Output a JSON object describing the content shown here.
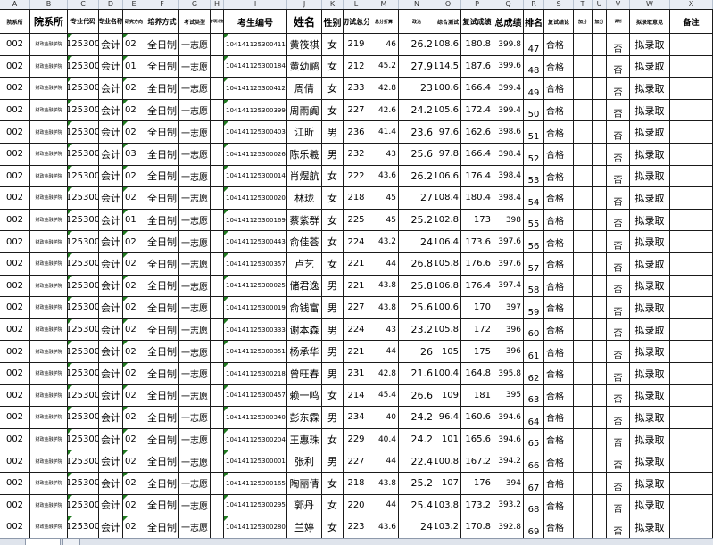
{
  "columns": [
    "A",
    "B",
    "C",
    "D",
    "E",
    "F",
    "G",
    "H",
    "I",
    "J",
    "K",
    "L",
    "M",
    "N",
    "O",
    "P",
    "Q",
    "R",
    "S",
    "T",
    "U",
    "V",
    "W",
    "X"
  ],
  "headers": [
    "院系所",
    "院系所",
    "专业代码",
    "专业名称",
    "研究方向",
    "培养方式",
    "考试类型",
    "专项计划",
    "考生编号",
    "姓名",
    "性别",
    "初试总分",
    "总分折算",
    "政治",
    "综合测试",
    "复试成绩",
    "总成绩",
    "排名",
    "复试结论",
    "加分",
    "加分",
    "调剂",
    "拟录取意见",
    "备注"
  ],
  "rows": [
    [
      "002",
      "财政金融学院",
      "125300",
      "会计",
      "02",
      "全日制",
      "一志愿",
      "",
      "104141125300411",
      "黄筱祺",
      "女",
      "219",
      "46",
      "26.2",
      "108.6",
      "180.8",
      "399.8",
      "47",
      "合格",
      "",
      "",
      "否",
      "拟录取",
      ""
    ],
    [
      "002",
      "财政金融学院",
      "125300",
      "会计",
      "01",
      "全日制",
      "一志愿",
      "",
      "104141125300184",
      "黄幼鹂",
      "女",
      "212",
      "45.2",
      "27.9",
      "114.5",
      "187.6",
      "399.6",
      "48",
      "合格",
      "",
      "",
      "否",
      "拟录取",
      ""
    ],
    [
      "002",
      "财政金融学院",
      "125300",
      "会计",
      "02",
      "全日制",
      "一志愿",
      "",
      "104141125300412",
      "周倩",
      "女",
      "233",
      "42.8",
      "23",
      "100.6",
      "166.4",
      "399.4",
      "49",
      "合格",
      "",
      "",
      "否",
      "拟录取",
      ""
    ],
    [
      "002",
      "财政金融学院",
      "125300",
      "会计",
      "02",
      "全日制",
      "一志愿",
      "",
      "104141125300399",
      "周雨阗",
      "女",
      "227",
      "42.6",
      "24.2",
      "105.6",
      "172.4",
      "399.4",
      "50",
      "合格",
      "",
      "",
      "否",
      "拟录取",
      ""
    ],
    [
      "002",
      "财政金融学院",
      "125300",
      "会计",
      "02",
      "全日制",
      "一志愿",
      "",
      "104141125300403",
      "江昕",
      "男",
      "236",
      "41.4",
      "23.6",
      "97.6",
      "162.6",
      "398.6",
      "51",
      "合格",
      "",
      "",
      "否",
      "拟录取",
      ""
    ],
    [
      "002",
      "财政金融学院",
      "125300",
      "会计",
      "03",
      "全日制",
      "一志愿",
      "",
      "104141125300026",
      "陈乐羲",
      "男",
      "232",
      "43",
      "25.6",
      "97.8",
      "166.4",
      "398.4",
      "52",
      "合格",
      "",
      "",
      "否",
      "拟录取",
      ""
    ],
    [
      "002",
      "财政金融学院",
      "125300",
      "会计",
      "02",
      "全日制",
      "一志愿",
      "",
      "104141125300014",
      "肖煜航",
      "女",
      "222",
      "43.6",
      "26.2",
      "106.6",
      "176.4",
      "398.4",
      "53",
      "合格",
      "",
      "",
      "否",
      "拟录取",
      ""
    ],
    [
      "002",
      "财政金融学院",
      "125300",
      "会计",
      "02",
      "全日制",
      "一志愿",
      "",
      "104141125300020",
      "林珑",
      "女",
      "218",
      "45",
      "27",
      "108.4",
      "180.4",
      "398.4",
      "54",
      "合格",
      "",
      "",
      "否",
      "拟录取",
      ""
    ],
    [
      "002",
      "财政金融学院",
      "125300",
      "会计",
      "01",
      "全日制",
      "一志愿",
      "",
      "104141125300169",
      "蔡紫群",
      "女",
      "225",
      "45",
      "25.2",
      "102.8",
      "173",
      "398",
      "55",
      "合格",
      "",
      "",
      "否",
      "拟录取",
      ""
    ],
    [
      "002",
      "财政金融学院",
      "125300",
      "会计",
      "02",
      "全日制",
      "一志愿",
      "",
      "104141125300443",
      "俞佳荟",
      "女",
      "224",
      "43.2",
      "24",
      "106.4",
      "173.6",
      "397.6",
      "56",
      "合格",
      "",
      "",
      "否",
      "拟录取",
      ""
    ],
    [
      "002",
      "财政金融学院",
      "125300",
      "会计",
      "02",
      "全日制",
      "一志愿",
      "",
      "104141125300357",
      "卢艺",
      "女",
      "221",
      "44",
      "26.8",
      "105.8",
      "176.6",
      "397.6",
      "57",
      "合格",
      "",
      "",
      "否",
      "拟录取",
      ""
    ],
    [
      "002",
      "财政金融学院",
      "125300",
      "会计",
      "02",
      "全日制",
      "一志愿",
      "",
      "104141125300025",
      "储君逸",
      "男",
      "221",
      "43.8",
      "25.8",
      "106.8",
      "176.4",
      "397.4",
      "58",
      "合格",
      "",
      "",
      "否",
      "拟录取",
      ""
    ],
    [
      "002",
      "财政金融学院",
      "125300",
      "会计",
      "02",
      "全日制",
      "一志愿",
      "",
      "104141125300019",
      "俞钱富",
      "男",
      "227",
      "43.8",
      "25.6",
      "100.6",
      "170",
      "397",
      "59",
      "合格",
      "",
      "",
      "否",
      "拟录取",
      ""
    ],
    [
      "002",
      "财政金融学院",
      "125300",
      "会计",
      "02",
      "全日制",
      "一志愿",
      "",
      "104141125300333",
      "谢本森",
      "男",
      "224",
      "43",
      "23.2",
      "105.8",
      "172",
      "396",
      "60",
      "合格",
      "",
      "",
      "否",
      "拟录取",
      ""
    ],
    [
      "002",
      "财政金融学院",
      "125300",
      "会计",
      "02",
      "全日制",
      "一志愿",
      "",
      "104141125300351",
      "杨承华",
      "男",
      "221",
      "44",
      "26",
      "105",
      "175",
      "396",
      "61",
      "合格",
      "",
      "",
      "否",
      "拟录取",
      ""
    ],
    [
      "002",
      "财政金融学院",
      "125300",
      "会计",
      "02",
      "全日制",
      "一志愿",
      "",
      "104141125300218",
      "曾旺春",
      "男",
      "231",
      "42.8",
      "21.6",
      "100.4",
      "164.8",
      "395.8",
      "62",
      "合格",
      "",
      "",
      "否",
      "拟录取",
      ""
    ],
    [
      "002",
      "财政金融学院",
      "125300",
      "会计",
      "02",
      "全日制",
      "一志愿",
      "",
      "104141125300457",
      "赖一鸣",
      "女",
      "214",
      "45.4",
      "26.6",
      "109",
      "181",
      "395",
      "63",
      "合格",
      "",
      "",
      "否",
      "拟录取",
      ""
    ],
    [
      "002",
      "财政金融学院",
      "125300",
      "会计",
      "02",
      "全日制",
      "一志愿",
      "",
      "104141125300340",
      "彭东霖",
      "男",
      "234",
      "40",
      "24.2",
      "96.4",
      "160.6",
      "394.6",
      "64",
      "合格",
      "",
      "",
      "否",
      "拟录取",
      ""
    ],
    [
      "002",
      "财政金融学院",
      "125300",
      "会计",
      "02",
      "全日制",
      "一志愿",
      "",
      "104141125300204",
      "王惠珠",
      "女",
      "229",
      "40.4",
      "24.2",
      "101",
      "165.6",
      "394.6",
      "65",
      "合格",
      "",
      "",
      "否",
      "拟录取",
      ""
    ],
    [
      "002",
      "财政金融学院",
      "125300",
      "会计",
      "02",
      "全日制",
      "一志愿",
      "",
      "104141125300001",
      "张利",
      "男",
      "227",
      "44",
      "22.4",
      "100.8",
      "167.2",
      "394.2",
      "66",
      "合格",
      "",
      "",
      "否",
      "拟录取",
      ""
    ],
    [
      "002",
      "财政金融学院",
      "125300",
      "会计",
      "02",
      "全日制",
      "一志愿",
      "",
      "104141125300165",
      "陶丽倩",
      "女",
      "218",
      "43.8",
      "25.2",
      "107",
      "176",
      "394",
      "67",
      "合格",
      "",
      "",
      "否",
      "拟录取",
      ""
    ],
    [
      "002",
      "财政金融学院",
      "125300",
      "会计",
      "02",
      "全日制",
      "一志愿",
      "",
      "104141125300295",
      "郭丹",
      "女",
      "220",
      "44",
      "25.4",
      "103.8",
      "173.2",
      "393.2",
      "68",
      "合格",
      "",
      "",
      "否",
      "拟录取",
      ""
    ],
    [
      "002",
      "财政金融学院",
      "125300",
      "会计",
      "02",
      "全日制",
      "一志愿",
      "",
      "104141125300280",
      "兰婷",
      "女",
      "223",
      "43.6",
      "24",
      "103.2",
      "170.8",
      "392.8",
      "69",
      "合格",
      "",
      "",
      "否",
      "拟录取",
      ""
    ]
  ]
}
